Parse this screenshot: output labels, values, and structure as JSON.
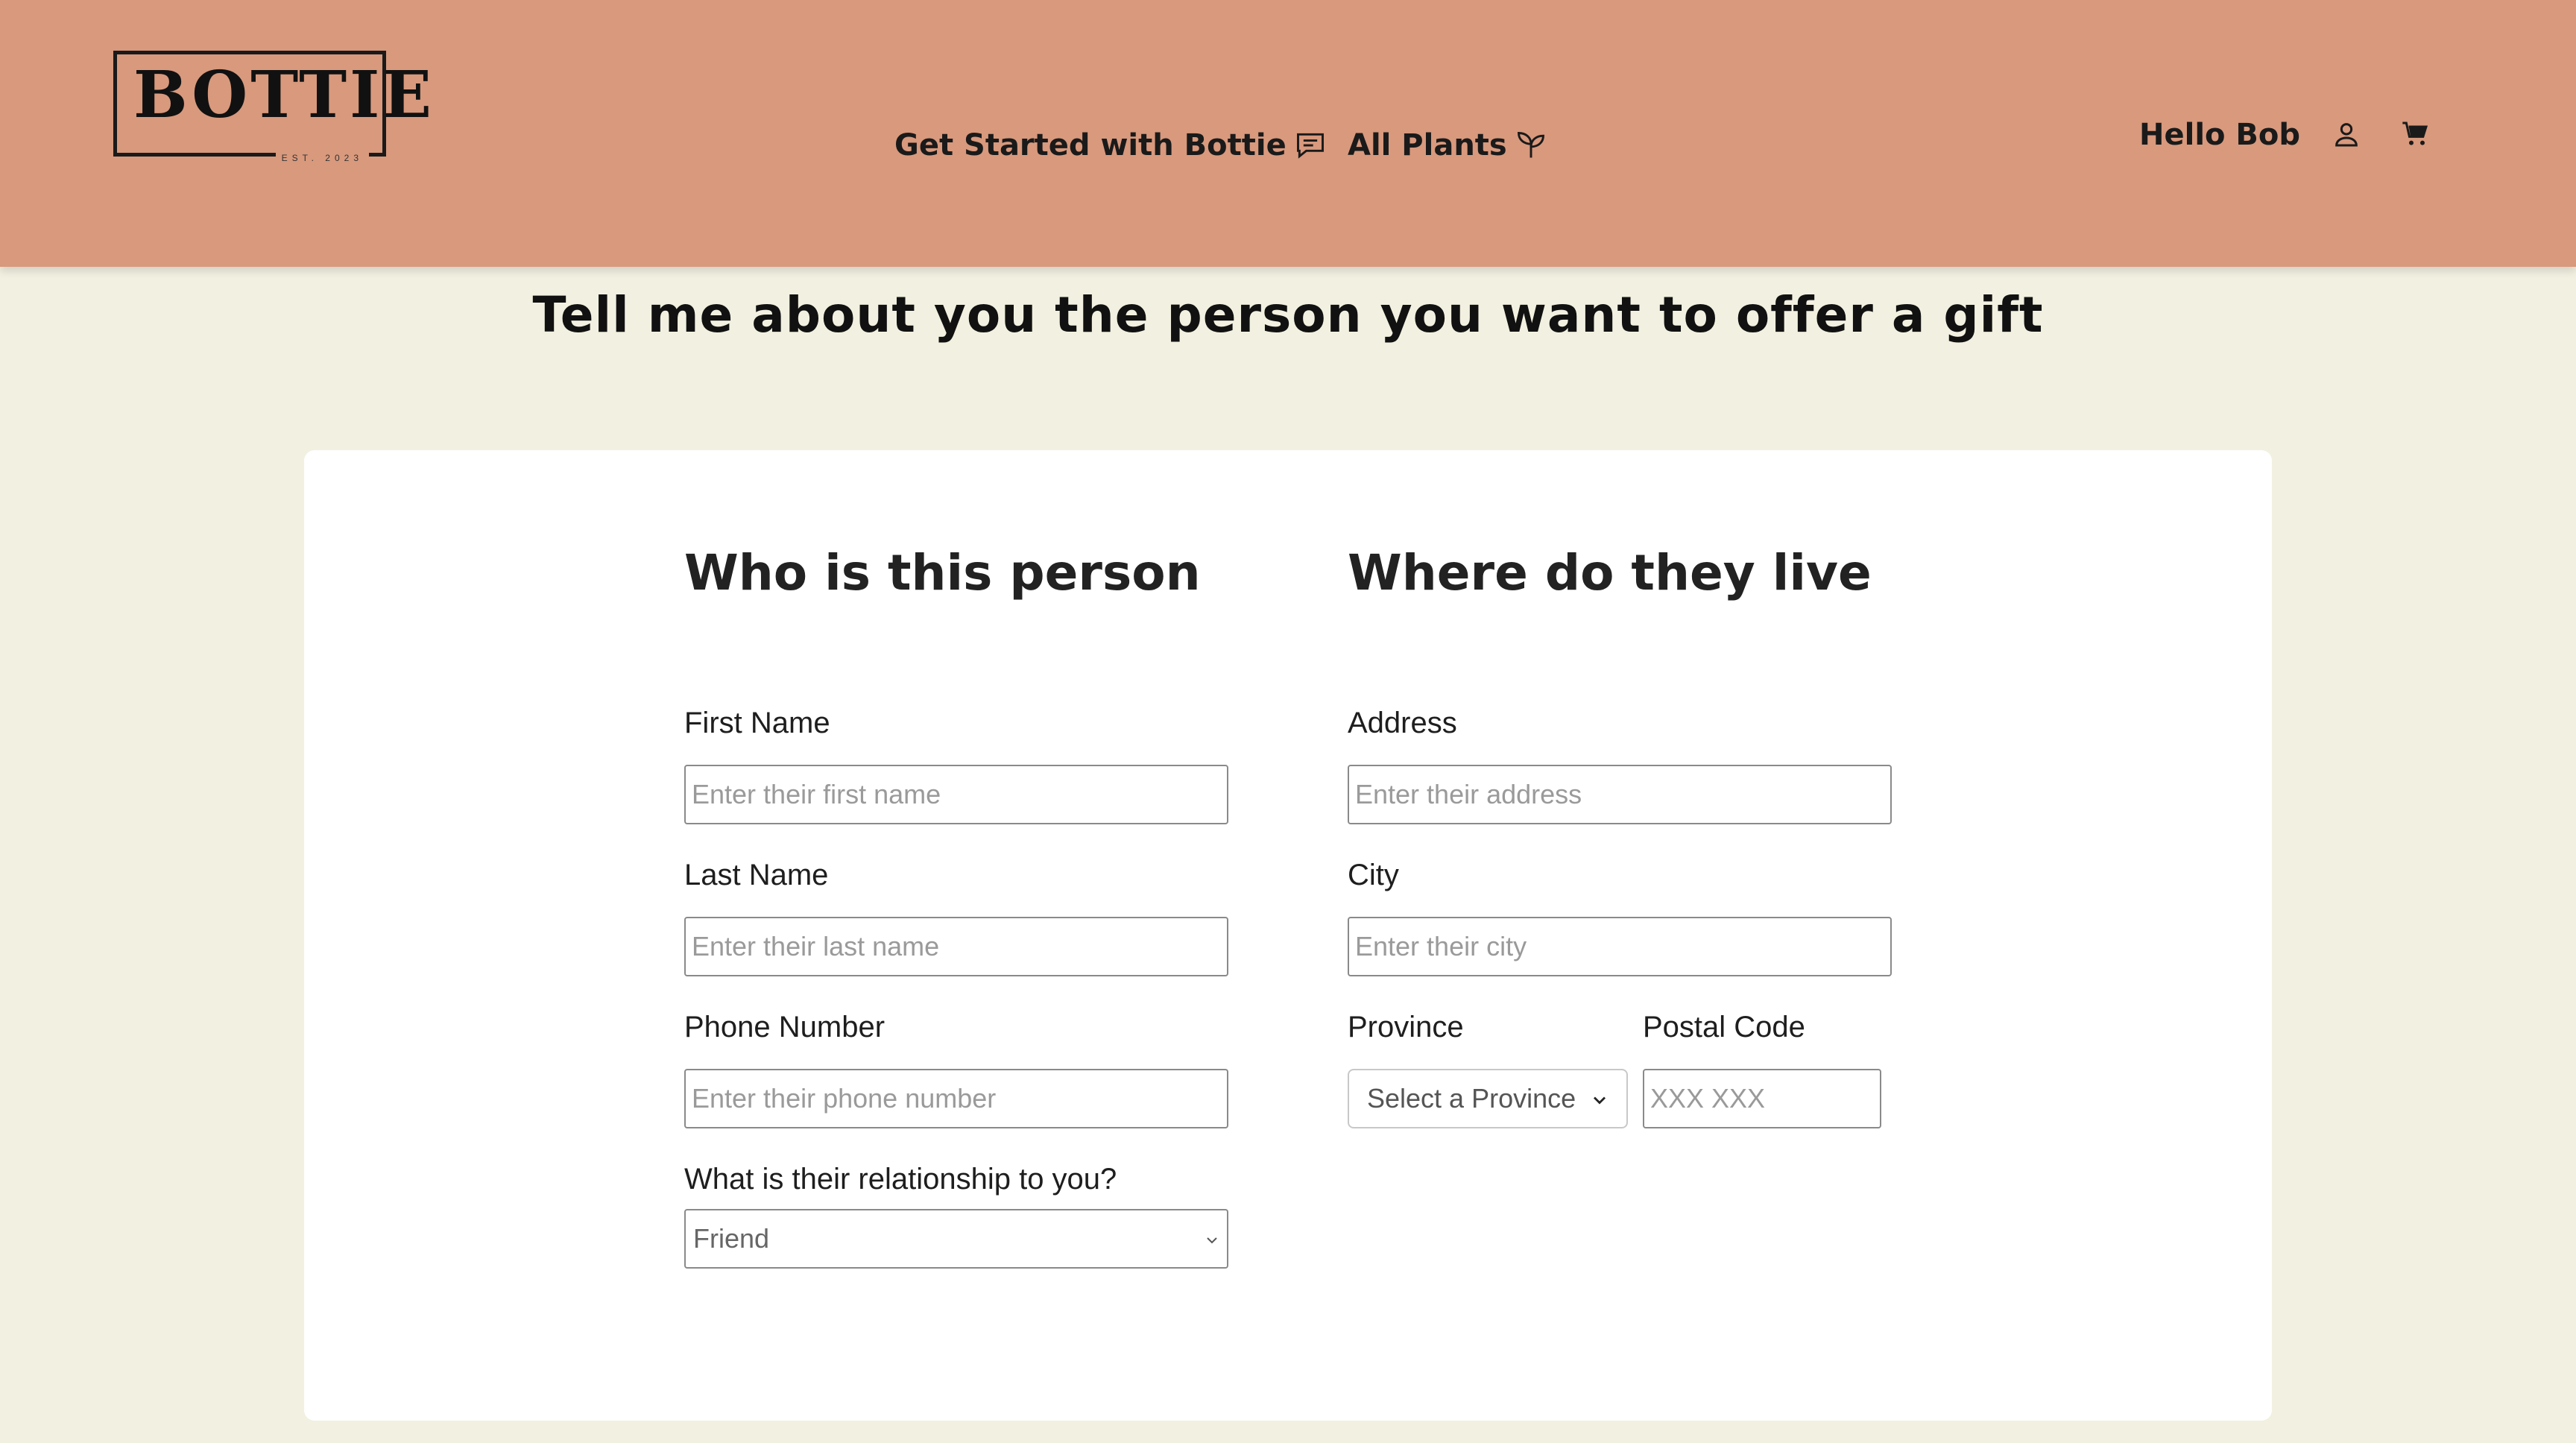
{
  "header": {
    "logo_text": "BOTTIE",
    "logo_est": "EST. 2023",
    "nav": {
      "get_started_label": "Get Started with Bottie",
      "get_started_icon": "chat-icon",
      "all_plants_label": "All Plants",
      "all_plants_icon": "sprout-icon"
    },
    "greeting": "Hello Bob",
    "icons": [
      "user-icon",
      "cart-icon"
    ],
    "background_color": "#d8997d"
  },
  "page": {
    "title": "Tell me about you the person you want to offer a gift",
    "background_color": "#f2f0e0"
  },
  "form": {
    "person": {
      "heading": "Who is this person",
      "first_name_label": "First Name",
      "first_name_placeholder": "Enter their first name",
      "first_name_value": "",
      "last_name_label": "Last Name",
      "last_name_placeholder": "Enter their last name",
      "last_name_value": "",
      "phone_label": "Phone Number",
      "phone_placeholder": "Enter their phone number",
      "phone_value": "",
      "relationship_label": "What is their relationship to you?",
      "relationship_value": "Friend"
    },
    "address": {
      "heading": "Where do they live",
      "address_label": "Address",
      "address_placeholder": "Enter their address",
      "address_value": "",
      "city_label": "City",
      "city_placeholder": "Enter their city",
      "city_value": "",
      "province_label": "Province",
      "province_value": "Select a Province",
      "postal_label": "Postal Code",
      "postal_placeholder": "XXX XXX",
      "postal_value": ""
    }
  }
}
